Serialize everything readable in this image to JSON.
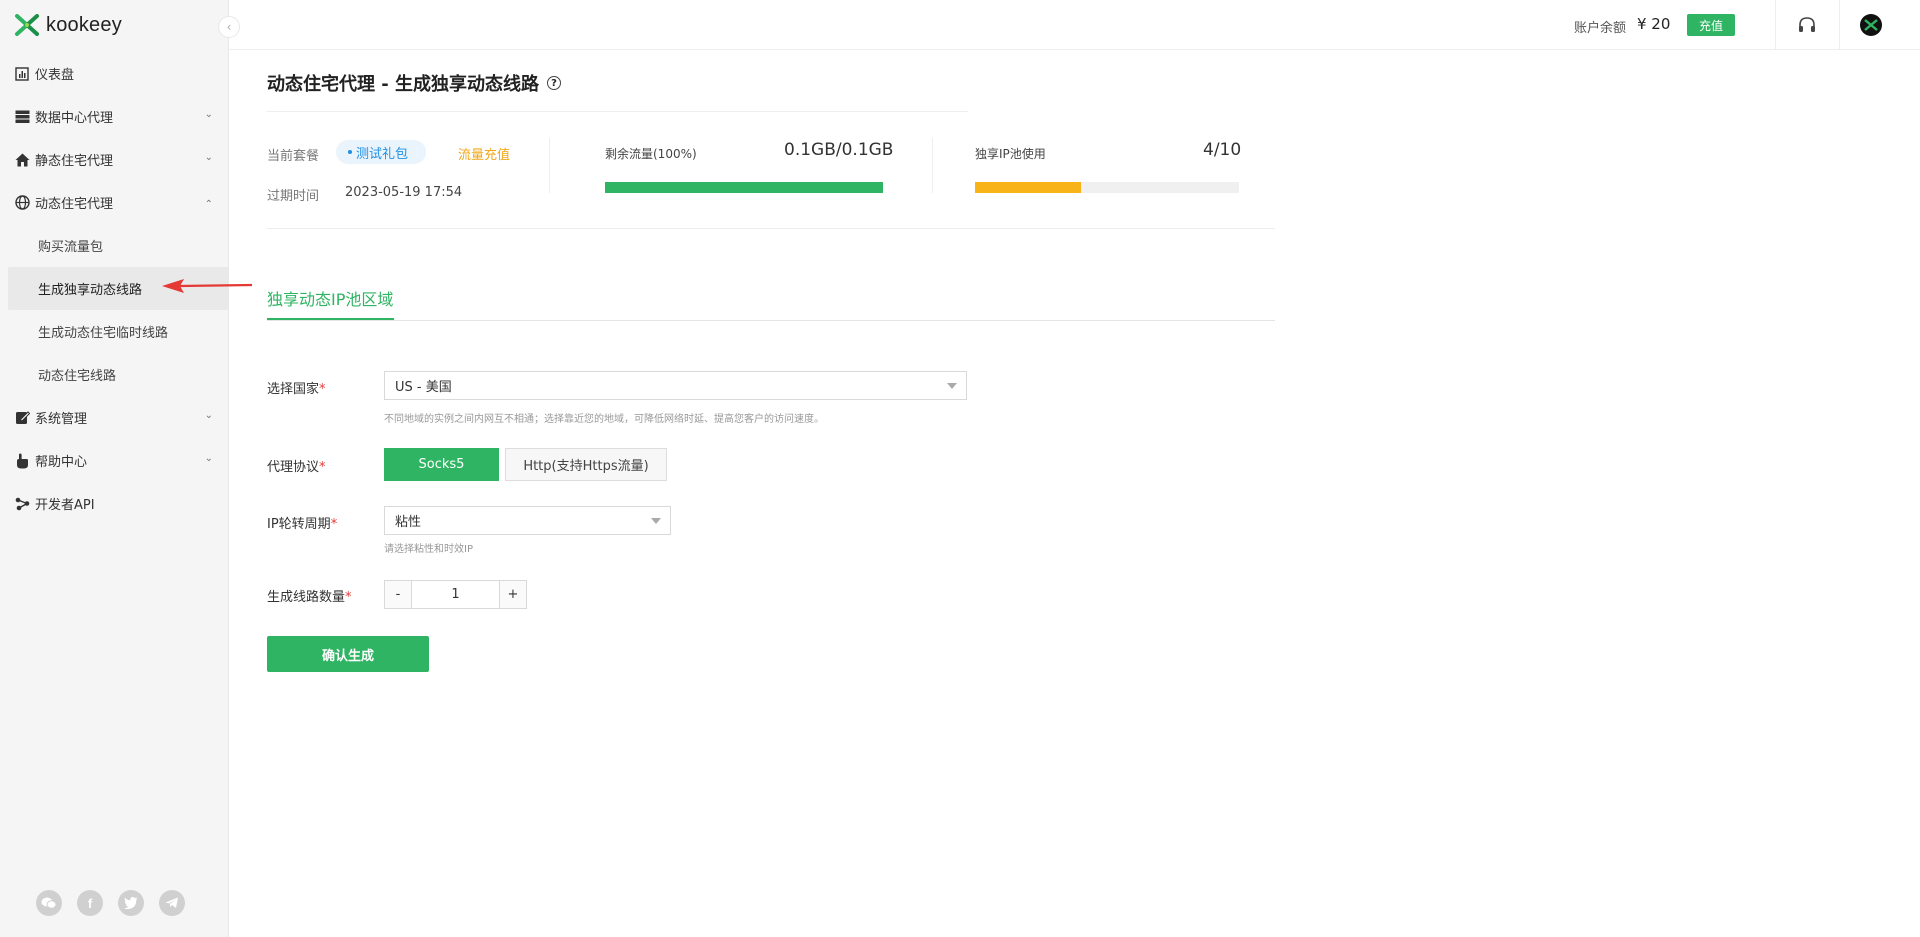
{
  "brand": {
    "name": "kookeey"
  },
  "sidebar": {
    "items": [
      {
        "label": "仪表盘",
        "icon": "dashboard-icon"
      },
      {
        "label": "数据中心代理",
        "icon": "datacenter-icon",
        "chevron": "down"
      },
      {
        "label": "静态住宅代理",
        "icon": "home-icon",
        "chevron": "down"
      },
      {
        "label": "动态住宅代理",
        "icon": "globe-icon",
        "chevron": "up",
        "children": [
          "购买流量包",
          "生成独享动态线路",
          "生成动态住宅临时线路",
          "动态住宅线路"
        ]
      },
      {
        "label": "系统管理",
        "icon": "edit-icon",
        "chevron": "down"
      },
      {
        "label": "帮助中心",
        "icon": "hand-icon",
        "chevron": "down"
      },
      {
        "label": "开发者API",
        "icon": "api-share-icon"
      }
    ],
    "active_child": "生成独享动态线路",
    "social": [
      "wechat-icon",
      "facebook-icon",
      "twitter-icon",
      "telegram-icon"
    ]
  },
  "topbar": {
    "balance_label": "账户余额",
    "balance_value": "¥ 20",
    "recharge_label": "充值"
  },
  "page": {
    "title": "动态住宅代理 - 生成独享动态线路"
  },
  "summary": {
    "package_label": "当前套餐",
    "package_name": "测试礼包",
    "topup_label": "流量充值",
    "expire_label": "过期时间",
    "expire_value": "2023-05-19 17:54",
    "traffic_label": "剩余流量(100%)",
    "traffic_value": "0.1GB/0.1GB",
    "traffic_fraction": 1.0,
    "pool_label": "独享IP池使用",
    "pool_value": "4/10",
    "pool_fraction": 0.4
  },
  "tabs": {
    "active": "独享动态IP池区域"
  },
  "form": {
    "country_label": "选择国家",
    "country_value": "US - 美国",
    "country_hint": "不同地域的实例之间内网互不相通；选择靠近您的地域，可降低网络时延、提高您客户的访问速度。",
    "protocol_label": "代理协议",
    "protocol_options": [
      "Socks5",
      "Http(支持Https流量)"
    ],
    "protocol_selected": "Socks5",
    "rotation_label": "IP轮转周期",
    "rotation_value": "粘性",
    "rotation_hint": "请选择粘性和时效IP",
    "count_label": "生成线路数量",
    "count_minus": "-",
    "count_value": "1",
    "count_plus": "+",
    "submit_label": "确认生成"
  },
  "colors": {
    "accent": "#2fb463",
    "warning": "#f0a81a",
    "link": "#1e90e6",
    "required": "#e53935",
    "annotation_arrow": "#e53935"
  }
}
